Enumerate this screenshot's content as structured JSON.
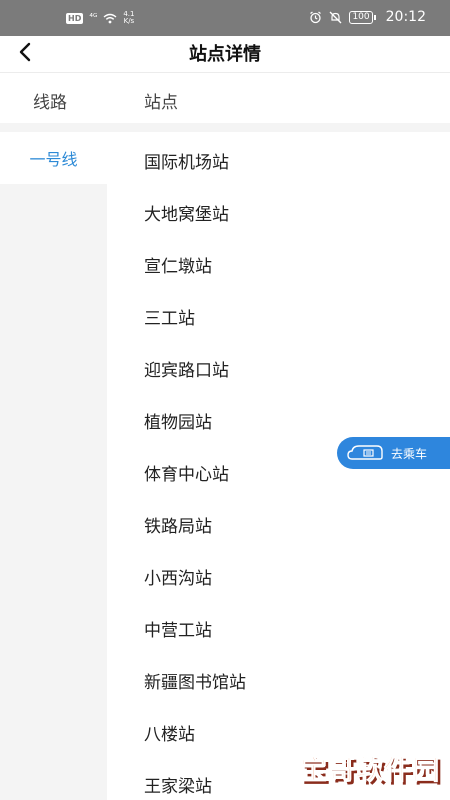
{
  "status_bar": {
    "badge": "HD",
    "signal": "⁴ᴳ",
    "speed_value": "4.1",
    "speed_unit": "K/s",
    "battery": "100",
    "time": "20:12",
    "icons": [
      "hd-badge-icon",
      "signal-icon",
      "wifi-icon",
      "alarm-icon",
      "mute-icon",
      "battery-icon"
    ]
  },
  "header": {
    "title": "站点详情",
    "back_icon": "back-arrow-icon"
  },
  "columns": {
    "lines_label": "线路",
    "stations_label": "站点"
  },
  "lines": [
    {
      "label": "一号线",
      "selected": true,
      "color": "#2d8ad6"
    }
  ],
  "stations": [
    "国际机场站",
    "大地窝堡站",
    "宣仁墩站",
    "三工站",
    "迎宾路口站",
    "植物园站",
    "体育中心站",
    "铁路局站",
    "小西沟站",
    "中营工站",
    "新疆图书馆站",
    "八楼站",
    "王家梁站"
  ],
  "float_button": {
    "label": "去乘车",
    "icon": "ride-code-icon",
    "color": "#2e86dd"
  },
  "watermark": {
    "text": "宝哥软件园"
  }
}
